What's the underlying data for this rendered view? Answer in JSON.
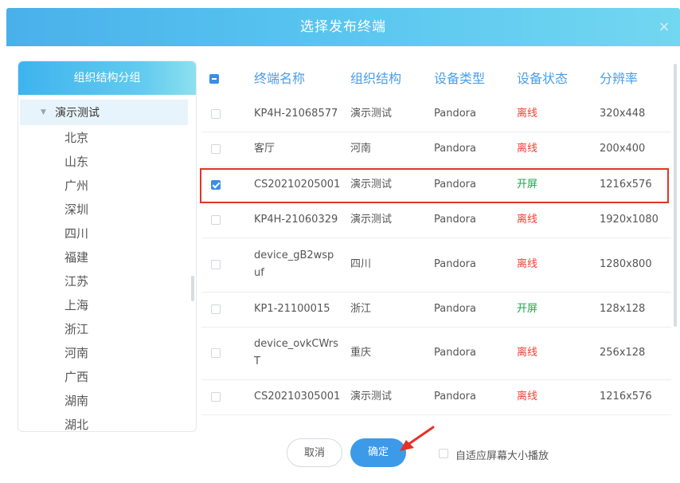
{
  "dialog": {
    "title": "选择发布终端",
    "close_glyph": "×"
  },
  "org_panel": {
    "header": "组织结构分组",
    "root": {
      "label": "演示测试",
      "caret": "▼"
    },
    "children": [
      "北京",
      "山东",
      "广州",
      "深圳",
      "四川",
      "福建",
      "江苏",
      "上海",
      "浙江",
      "河南",
      "广西",
      "湖南",
      "湖北"
    ]
  },
  "table": {
    "header_checkbox": "indeterminate",
    "columns": [
      "终端名称",
      "组织结构",
      "设备类型",
      "设备状态",
      "分辨率"
    ],
    "rows": [
      {
        "checked": false,
        "name": "KP4H-21068577",
        "org": "演示测试",
        "type": "Pandora",
        "status": "离线",
        "status_kind": "offline",
        "resolution": "320x448"
      },
      {
        "checked": false,
        "name": "客厅",
        "org": "河南",
        "type": "Pandora",
        "status": "离线",
        "status_kind": "offline",
        "resolution": "200x400"
      },
      {
        "checked": true,
        "name": "CS20210205001",
        "org": "演示测试",
        "type": "Pandora",
        "status": "开屏",
        "status_kind": "on",
        "resolution": "1216x576"
      },
      {
        "checked": false,
        "name": "KP4H-21060329",
        "org": "演示测试",
        "type": "Pandora",
        "status": "离线",
        "status_kind": "offline",
        "resolution": "1920x1080"
      },
      {
        "checked": false,
        "name_lines": [
          "device_gB2wsp",
          "uf"
        ],
        "org": "四川",
        "type": "Pandora",
        "status": "离线",
        "status_kind": "offline",
        "resolution": "1280x800"
      },
      {
        "checked": false,
        "name": "KP1-21100015",
        "org": "浙江",
        "type": "Pandora",
        "status": "开屏",
        "status_kind": "on",
        "resolution": "128x128"
      },
      {
        "checked": false,
        "name_lines": [
          "device_ovkCWrs",
          "T"
        ],
        "org": "重庆",
        "type": "Pandora",
        "status": "离线",
        "status_kind": "offline",
        "resolution": "256x128"
      },
      {
        "checked": false,
        "name": "CS20210305001",
        "org": "演示测试",
        "type": "Pandora",
        "status": "离线",
        "status_kind": "offline",
        "resolution": "1216x576"
      }
    ]
  },
  "footer": {
    "cancel_label": "取消",
    "ok_label": "确定",
    "adaptive_label": "自适应屏幕大小播放",
    "adaptive_checked": false
  },
  "colors": {
    "accent": "#3c9ae8",
    "offline": "#f04134",
    "online": "#19a84a",
    "highlight": "#e4322a"
  }
}
